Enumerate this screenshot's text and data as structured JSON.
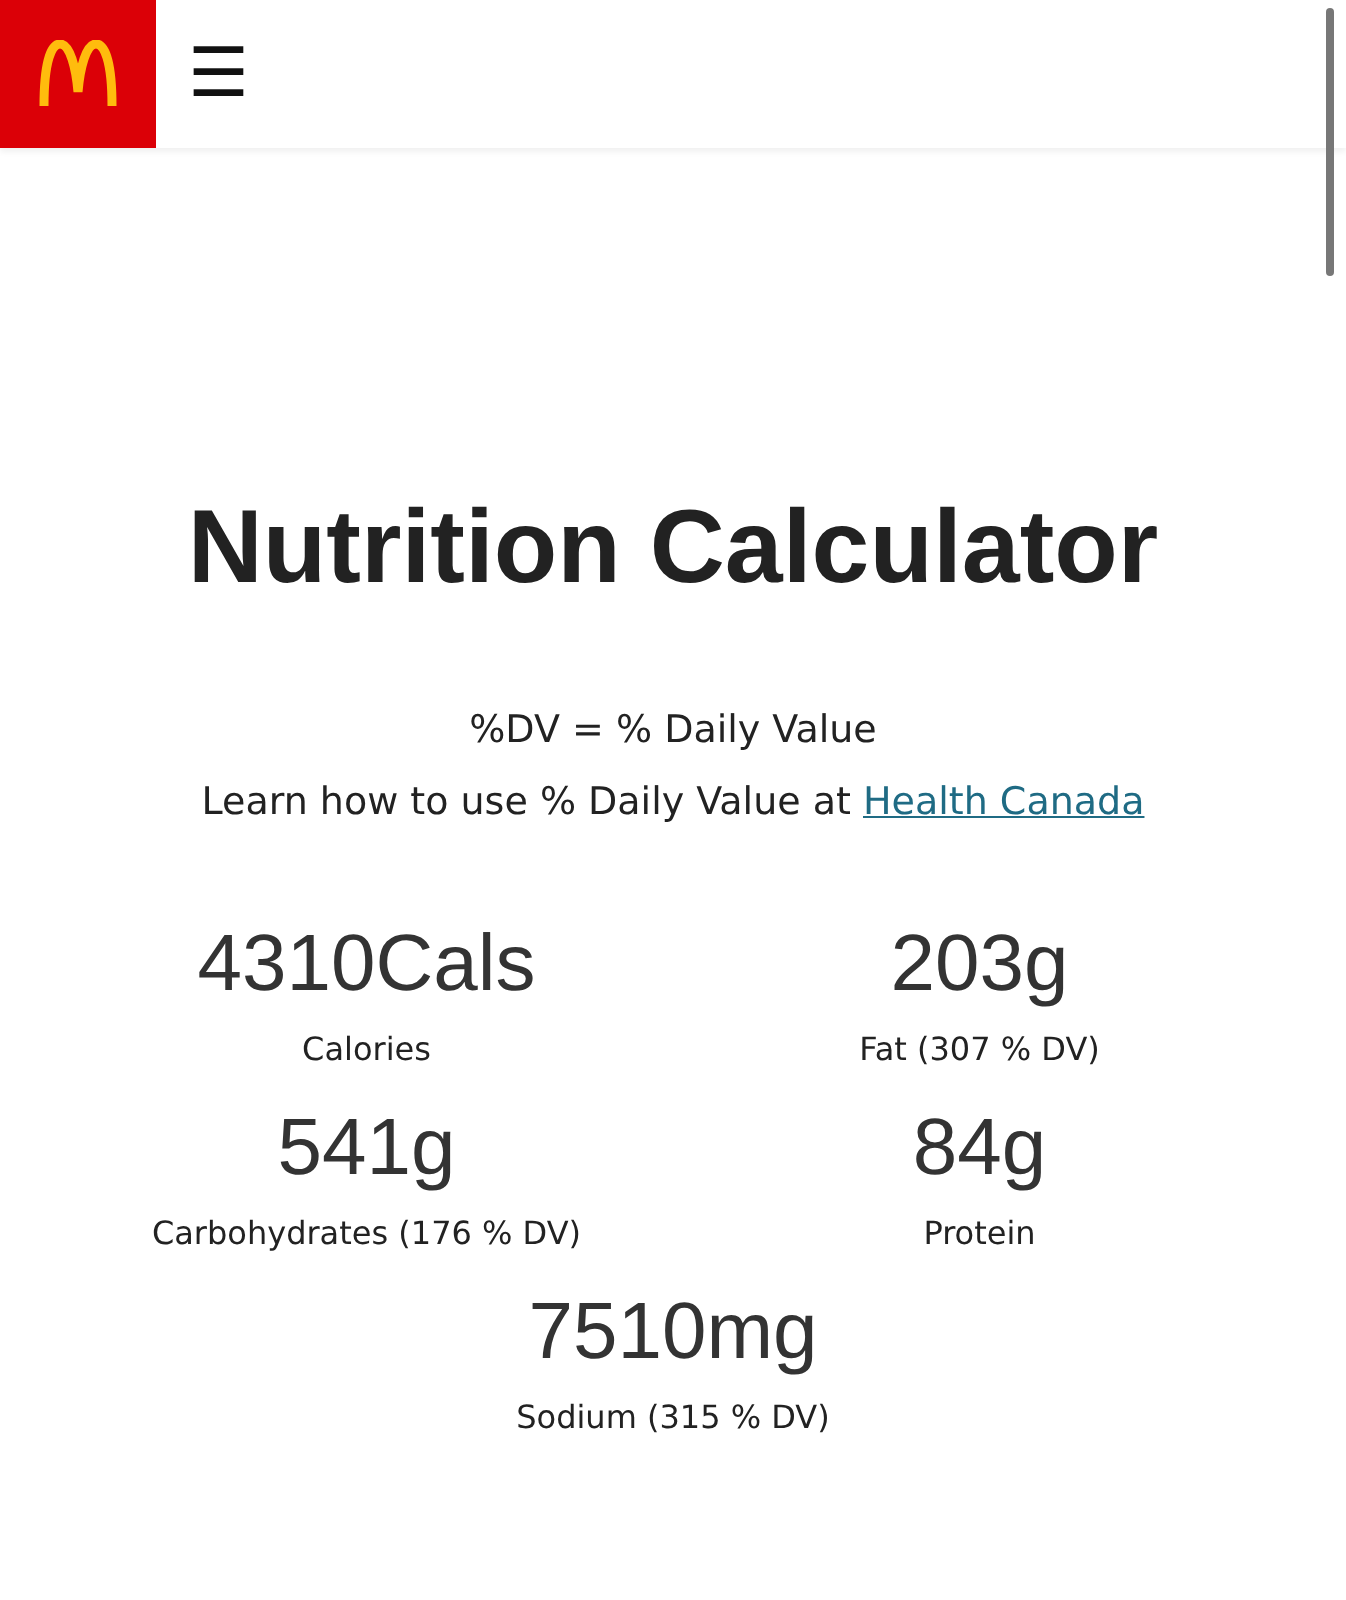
{
  "header": {
    "menu_label": "☰"
  },
  "title": "Nutrition Calculator",
  "legend": "%DV = % Daily Value",
  "learn": {
    "text": "Learn how to use % Daily Value at ",
    "link": "Health Canada"
  },
  "nutrients": [
    {
      "value": "4310Cals",
      "label": "Calories"
    },
    {
      "value": "203g",
      "label": "Fat (307 % DV)"
    },
    {
      "value": "541g",
      "label": "Carbohydrates (176 % DV)"
    },
    {
      "value": "84g",
      "label": "Protein"
    },
    {
      "value": "7510mg",
      "label": "Sodium (315 % DV)"
    }
  ]
}
